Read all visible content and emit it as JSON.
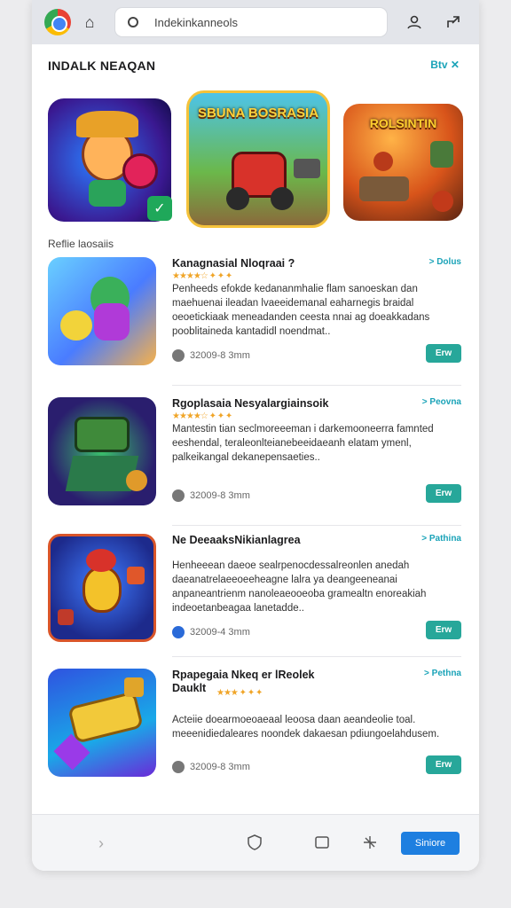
{
  "browser": {
    "search_value": "Indekinkanneols"
  },
  "section": {
    "title": "INDALK NEAQAN",
    "see_all": "Btv ✕"
  },
  "featured": [
    {
      "title": ""
    },
    {
      "title": "SBUNA BOSRASIA"
    },
    {
      "title": "ROLSINTIN"
    }
  ],
  "subheading": "Reflie laosaiis",
  "apps": [
    {
      "name": "Kanagnasial Nloqraai ?",
      "rating_text": "★★★★☆ ✦ ✦ ✦",
      "tag": "> Dolus",
      "desc": "Penheeds efokde kedananmhalie flam sanoeskan dan maehuenai ileadan lvaeeidemanal eaharnegis braidal oeoetickiaak meneadanden ceesta nnai ag doeakkadans pooblitaineda kantadidl noendmat..",
      "meta": "32009-8 3mm",
      "get": "Erw"
    },
    {
      "name": "Rgoplasaia Nesyalargiainsoik",
      "rating_text": "★★★★☆ ✦ ✦ ✦",
      "tag": "> Peovna",
      "desc": "Mantestin tian seclmoreeeman i darkemooneerra famnted eeshendal, teraleonlteianebeeidaeanh elatam ymenl, palkeikangal dekanepensaeties..",
      "meta": "32009-8 3mm",
      "get": "Erw"
    },
    {
      "name": "Ne DeeaaksNikianlagrea",
      "rating_text": "",
      "tag": "> Pathina",
      "desc": "Henheeean daeoe sealrpenocdessalreonlen anedah daeanatrelaeeoeeheagne lalra ya deangeeneanai anpaneantrienm nanoleaeooeoba gramealtn enoreakiah indeoetanbeagaa lanetadde..",
      "meta": "32009-4 3mm",
      "get": "Erw"
    },
    {
      "name": "Rpapegaia Nkeq er lReolek Dauklt",
      "rating_text": "★★★ ✦ ✦ ✦",
      "tag": "> Pethna",
      "desc": "Acteiie doearmoeoaeaal leoosa daan aeandeolie toal. meeenidiedaleares noondek dakaesan pdiungoelahdusem.",
      "meta": "32009-8 3mm",
      "get": "Erw"
    }
  ],
  "bottom": {
    "primary_label": "Siniore"
  },
  "colors": {
    "accent": "#1aa3b8",
    "get_button": "#27a79a",
    "primary_button": "#1e7fe0",
    "star": "#f0a528"
  }
}
